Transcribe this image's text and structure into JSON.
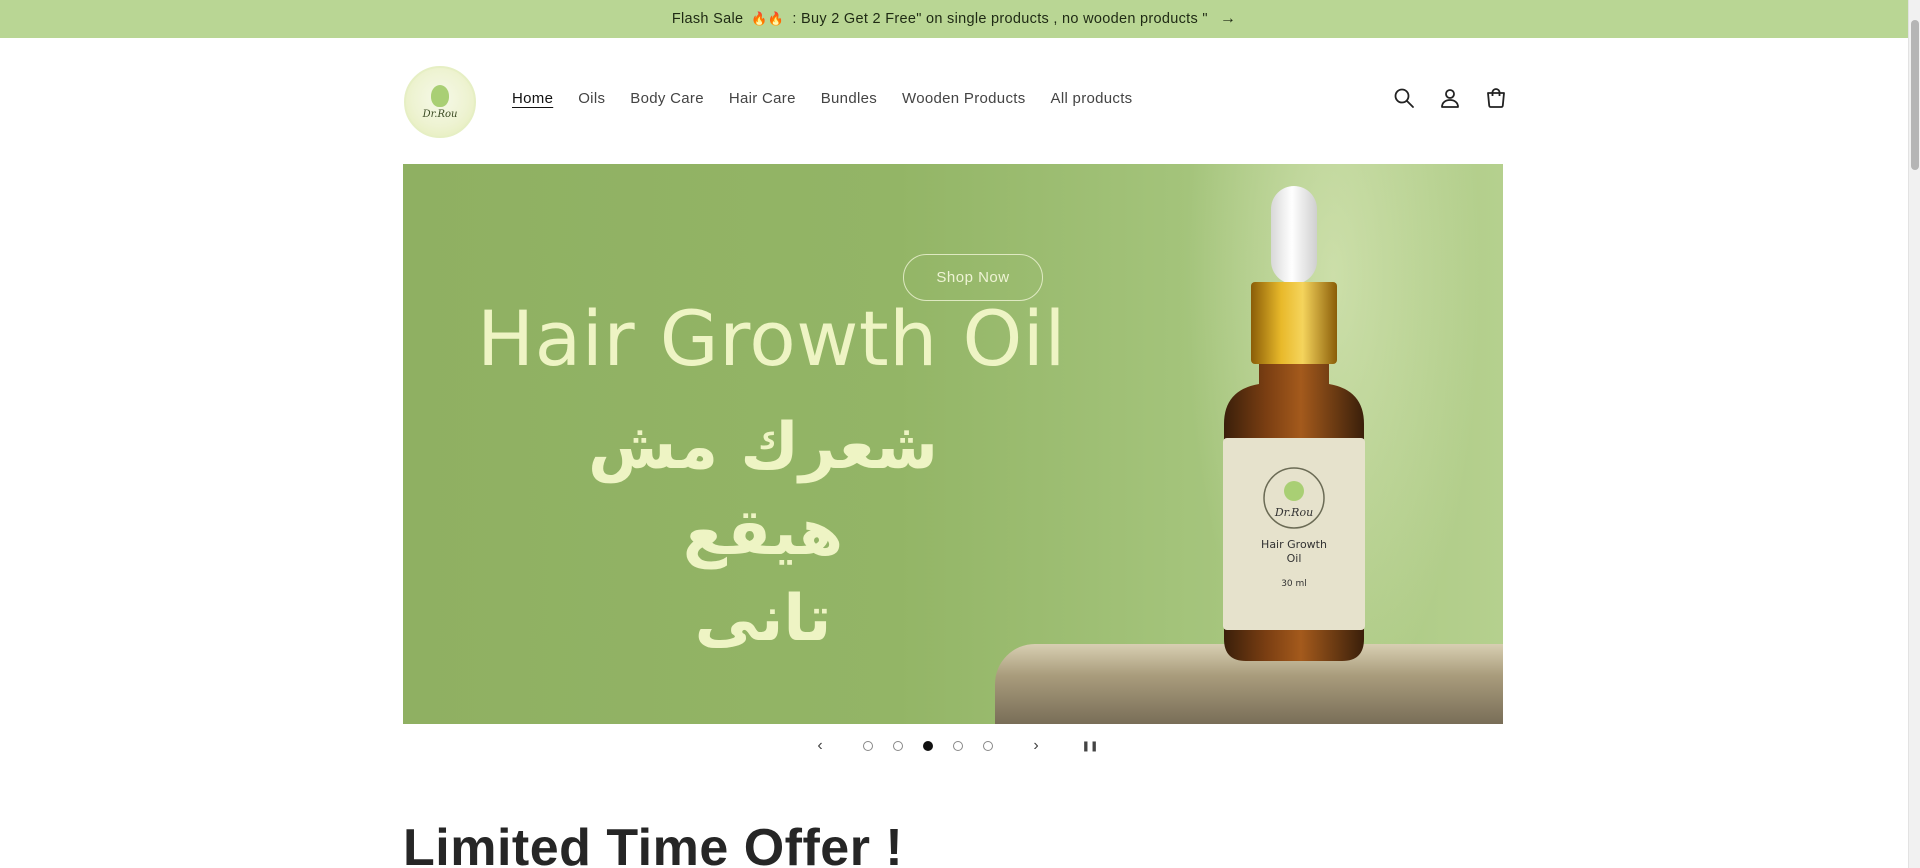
{
  "announcement": {
    "text_before": "Flash Sale",
    "fire_icons": "🔥🔥",
    "text_after": ": Buy 2 Get 2 Free\" on single products , no wooden products \"",
    "arrow": "→"
  },
  "header": {
    "logo_text": "Dr.Rou",
    "nav": [
      {
        "label": "Home"
      },
      {
        "label": "Oils"
      },
      {
        "label": "Body Care"
      },
      {
        "label": "Hair Care"
      },
      {
        "label": "Bundles"
      },
      {
        "label": "Wooden Products"
      },
      {
        "label": "All products"
      }
    ],
    "icons": [
      "search-icon",
      "account-icon",
      "cart-icon"
    ]
  },
  "hero": {
    "button_label": "Shop Now",
    "title_en": "Hair Growth Oil",
    "title_ar_line1": "شعرك مش هيقع",
    "title_ar_line2": "تانى",
    "bottle_label_line1": "Hair Growth",
    "bottle_label_line2": "Oil",
    "bottle_volume": "30 ml"
  },
  "slider": {
    "prev": "‹",
    "next": "›",
    "pause": "❚❚",
    "total_slides": 5,
    "active_slide": 3
  },
  "section": {
    "title": "Limited Time Offer !"
  },
  "colors": {
    "announcement_bg": "#b9d694",
    "hero_bg": "#93b566",
    "hero_text": "#eef4c4"
  }
}
